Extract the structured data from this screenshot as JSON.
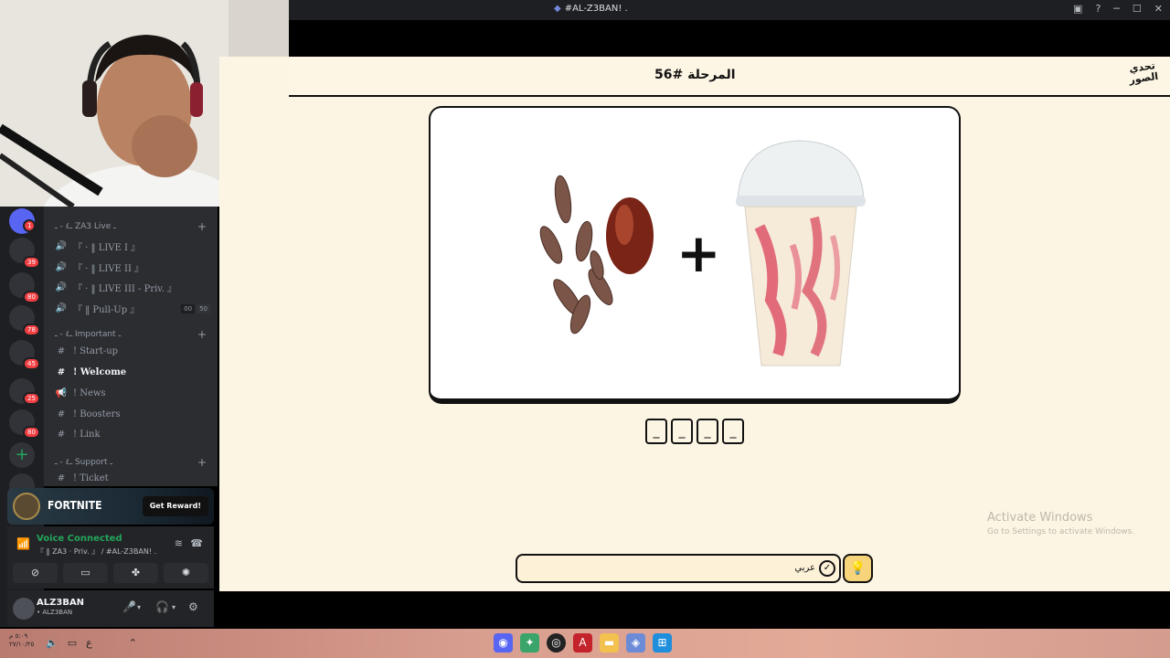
{
  "window": {
    "title": "#AL-Z3BAN! .",
    "controls": [
      "inbox-icon",
      "help-icon",
      "minimize-icon",
      "maximize-icon",
      "close-icon"
    ]
  },
  "discord": {
    "categories": [
      {
        "label": "ـ٤ - ـ ZA3 Live ـ",
        "top": 0
      },
      {
        "label": "ـ٤ - ـ Important ـ",
        "top": 0
      },
      {
        "label": "ـ٤ - ـ Support ـ",
        "top": 0
      }
    ],
    "voice_channels": [
      {
        "label": "『 · ‖ LIVE I 』"
      },
      {
        "label": "『 · ‖ LIVE II 』"
      },
      {
        "label": "『 · ‖ LIVE III - Priv. 』"
      },
      {
        "label": "『 ‖ Pull-Up 』",
        "counter_a": "00",
        "counter_b": "50"
      }
    ],
    "text_channels": [
      {
        "label": "! Start-up"
      },
      {
        "label": "! Welcome"
      },
      {
        "label": "! News"
      },
      {
        "label": "! Boosters"
      },
      {
        "label": "! Link"
      },
      {
        "label": "! Ticket"
      }
    ],
    "server_badges": [
      "1",
      "39",
      "80",
      "78",
      "45",
      "25",
      "80"
    ],
    "promo": {
      "game": "FORTNITE",
      "button": "Get Reward!"
    },
    "voice": {
      "status": "Voice Connected",
      "channel": "『 ‖ ZA3 · Priv. 』 / #AL-Z3BAN! ."
    },
    "user": {
      "name": "ALZ3BAN",
      "status": "• ALZ3BAN"
    }
  },
  "game": {
    "stage_title": "المرحلة #56",
    "logo_text": "تحدي الصور",
    "operator": "+",
    "slots": [
      "_",
      "_",
      "_",
      "_"
    ],
    "answer_placeholder": "",
    "language_label": "عربي",
    "hint_icon": "lightbulb-icon"
  },
  "watermark": {
    "title": "Activate Windows",
    "subtitle": "Go to Settings to activate Windows."
  },
  "taskbar": {
    "clock_line1": "٥:٠٩ م",
    "clock_line2": "٢٧/١٠/٢٥",
    "lang": "ع"
  }
}
